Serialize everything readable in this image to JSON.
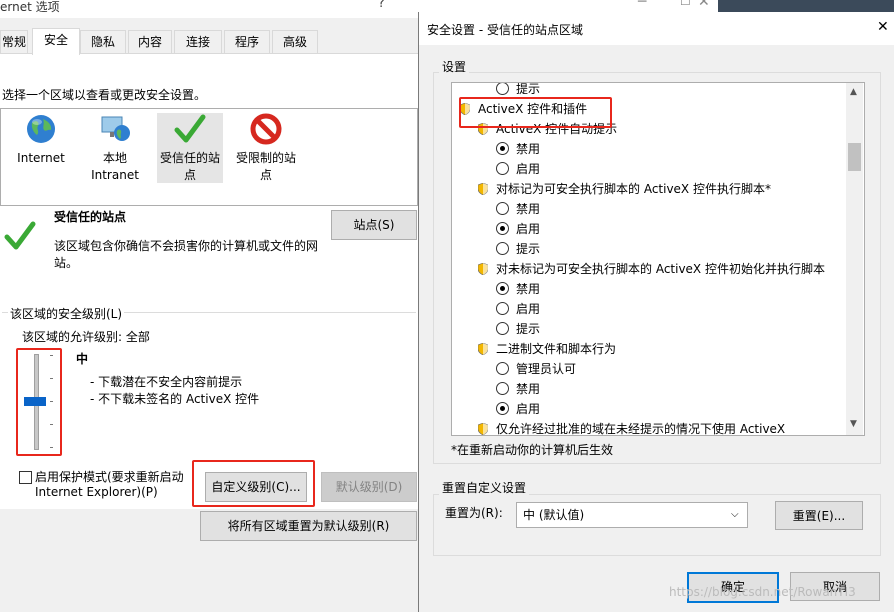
{
  "left_dialog": {
    "title": "ernet 选项",
    "title_help": "?",
    "tabs": [
      "常规",
      "安全",
      "隐私",
      "内容",
      "连接",
      "程序",
      "高级"
    ],
    "instruction": "选择一个区域以查看或更改安全设置。",
    "zones": [
      "Internet",
      "本地\nIntranet",
      "受信任的站\n点",
      "受限制的站\n点"
    ],
    "zone_info_title": "受信任的站点",
    "zone_info_desc": "该区域包含你确信不会损害你的计算机或文件的网\n站。",
    "sites_button": "站点(S)",
    "security_level_label": "该区域的安全级别(L)",
    "allowed_levels": "该区域的允许级别: 全部",
    "level_name": "中",
    "level_desc_1": "- 下载潜在不安全内容前提示",
    "level_desc_2": "- 不下载未签名的 ActiveX 控件",
    "protected_mode": "启用保护模式(要求重新启动",
    "protected_mode_2": "Internet Explorer)(P)",
    "custom_level_button": "自定义级别(C)...",
    "default_level_button": "默认级别(D)",
    "reset_all_button": "将所有区域重置为默认级别(R)",
    "slider_level_fraction": 0.5
  },
  "right_dialog": {
    "title": "安全设置 - 受信任的站点区域",
    "close_glyph": "✕",
    "settings_group": "设置",
    "settings_rows": [
      {
        "type": "radio",
        "label": "提示",
        "checked": false
      },
      {
        "type": "header",
        "label": "ActiveX 控件和插件"
      },
      {
        "type": "sub",
        "label": "ActiveX 控件自动提示"
      },
      {
        "type": "radio",
        "label": "禁用",
        "checked": true
      },
      {
        "type": "radio",
        "label": "启用",
        "checked": false
      },
      {
        "type": "sub",
        "label": "对标记为可安全执行脚本的 ActiveX 控件执行脚本*"
      },
      {
        "type": "radio",
        "label": "禁用",
        "checked": false
      },
      {
        "type": "radio",
        "label": "启用",
        "checked": true
      },
      {
        "type": "radio",
        "label": "提示",
        "checked": false
      },
      {
        "type": "sub",
        "label": "对未标记为可安全执行脚本的 ActiveX 控件初始化并执行脚本"
      },
      {
        "type": "radio",
        "label": "禁用",
        "checked": true
      },
      {
        "type": "radio",
        "label": "启用",
        "checked": false
      },
      {
        "type": "radio",
        "label": "提示",
        "checked": false
      },
      {
        "type": "sub",
        "label": "二进制文件和脚本行为"
      },
      {
        "type": "radio",
        "label": "管理员认可",
        "checked": false
      },
      {
        "type": "radio",
        "label": "禁用",
        "checked": false
      },
      {
        "type": "radio",
        "label": "启用",
        "checked": true
      },
      {
        "type": "sub",
        "label": "仅允许经过批准的域在未经提示的情况下使用 ActiveX"
      }
    ],
    "restart_note": "*在重新启动你的计算机后生效",
    "reset_group": "重置自定义设置",
    "reset_to_label": "重置为(R):",
    "reset_to_value": "中 (默认值)",
    "reset_button": "重置(E)...",
    "ok_button": "确定",
    "cancel_button": "取消",
    "watermark": "https://blog.csdn.net/RowanTI3"
  },
  "colors": {
    "highlight_red": "#e8271c",
    "ok_border": "#0078d7",
    "slider_thumb": "#0a64c8",
    "check_green": "#3aa935",
    "restricted_red": "#d6281f"
  }
}
